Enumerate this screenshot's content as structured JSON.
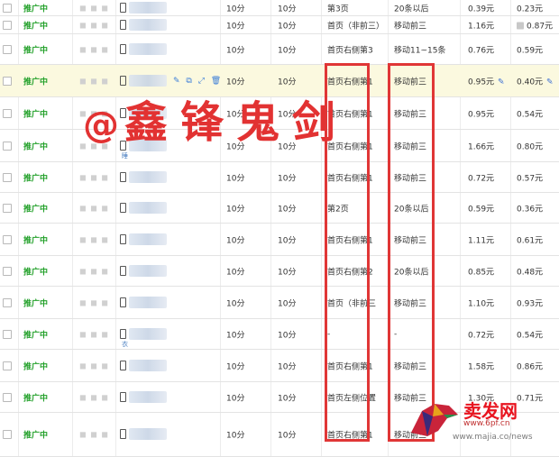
{
  "rows": [
    {
      "status": "推广中",
      "t1": "10分",
      "t2": "10分",
      "pos": "第3页",
      "dev": "20条以后",
      "b1": "0.39元",
      "b2": "0.23元",
      "b2_icon": false,
      "pencil": false,
      "highlight": false,
      "tools": false,
      "sub": ""
    },
    {
      "status": "推广中",
      "t1": "10分",
      "t2": "10分",
      "pos": "首页（非前三）",
      "dev": "移动前三",
      "b1": "1.16元",
      "b2": "0.87元",
      "b2_icon": true,
      "pencil": false,
      "highlight": false,
      "tools": false,
      "sub": ""
    },
    {
      "status": "推广中",
      "t1": "10分",
      "t2": "10分",
      "pos": "首页右侧第3",
      "dev": "移动11~15条",
      "b1": "0.76元",
      "b2": "0.59元",
      "b2_icon": false,
      "pencil": false,
      "highlight": false,
      "tools": false,
      "sub": ""
    },
    {
      "status": "推广中",
      "t1": "10分",
      "t2": "10分",
      "pos": "首页右侧第1",
      "dev": "移动前三",
      "b1": "0.95元",
      "b2": "0.40元",
      "b2_icon": false,
      "pencil": true,
      "highlight": true,
      "tools": true,
      "sub": ""
    },
    {
      "status": "推广中",
      "t1": "10分",
      "t2": "10分",
      "pos": "首页右侧第1",
      "dev": "移动前三",
      "b1": "0.95元",
      "b2": "0.54元",
      "b2_icon": false,
      "pencil": false,
      "highlight": false,
      "tools": false,
      "sub": ""
    },
    {
      "status": "推广中",
      "t1": "10分",
      "t2": "10分",
      "pos": "首页右侧第1",
      "dev": "移动前三",
      "b1": "1.66元",
      "b2": "0.80元",
      "b2_icon": false,
      "pencil": false,
      "highlight": false,
      "tools": false,
      "sub": "睡"
    },
    {
      "status": "推广中",
      "t1": "10分",
      "t2": "10分",
      "pos": "首页右侧第1",
      "dev": "移动前三",
      "b1": "0.72元",
      "b2": "0.57元",
      "b2_icon": false,
      "pencil": false,
      "highlight": false,
      "tools": false,
      "sub": ""
    },
    {
      "status": "推广中",
      "t1": "10分",
      "t2": "10分",
      "pos": "第2页",
      "dev": "20条以后",
      "b1": "0.59元",
      "b2": "0.36元",
      "b2_icon": false,
      "pencil": false,
      "highlight": false,
      "tools": false,
      "sub": ""
    },
    {
      "status": "推广中",
      "t1": "10分",
      "t2": "10分",
      "pos": "首页右侧第1",
      "dev": "移动前三",
      "b1": "1.11元",
      "b2": "0.61元",
      "b2_icon": false,
      "pencil": false,
      "highlight": false,
      "tools": false,
      "sub": ""
    },
    {
      "status": "推广中",
      "t1": "10分",
      "t2": "10分",
      "pos": "首页右侧第2",
      "dev": "20条以后",
      "b1": "0.85元",
      "b2": "0.48元",
      "b2_icon": false,
      "pencil": false,
      "highlight": false,
      "tools": false,
      "sub": ""
    },
    {
      "status": "推广中",
      "t1": "10分",
      "t2": "10分",
      "pos": "首页（非前三",
      "dev": "移动前三",
      "b1": "1.10元",
      "b2": "0.93元",
      "b2_icon": false,
      "pencil": false,
      "highlight": false,
      "tools": false,
      "sub": ""
    },
    {
      "status": "推广中",
      "t1": "10分",
      "t2": "10分",
      "pos": "-",
      "dev": "-",
      "b1": "0.72元",
      "b2": "0.54元",
      "b2_icon": false,
      "pencil": false,
      "highlight": false,
      "tools": false,
      "sub": "衣"
    },
    {
      "status": "推广中",
      "t1": "10分",
      "t2": "10分",
      "pos": "首页右侧第1",
      "dev": "移动前三",
      "b1": "1.58元",
      "b2": "0.86元",
      "b2_icon": false,
      "pencil": false,
      "highlight": false,
      "tools": false,
      "sub": ""
    },
    {
      "status": "推广中",
      "t1": "10分",
      "t2": "10分",
      "pos": "首页左侧位置",
      "dev": "移动前三",
      "b1": "1.30元",
      "b2": "0.71元",
      "b2_icon": false,
      "pencil": false,
      "highlight": false,
      "tools": false,
      "sub": ""
    },
    {
      "status": "推广中",
      "t1": "10分",
      "t2": "10分",
      "pos": "首页右侧第1",
      "dev": "移动前三",
      "b1": "",
      "b2": "",
      "b2_icon": false,
      "pencil": false,
      "highlight": false,
      "tools": false,
      "sub": ""
    }
  ],
  "icons": {
    "keyword_tools": "✎ ⧉ ⤢ 🗑",
    "pencil": "✎"
  },
  "watermark": {
    "at": "@",
    "name": "鑫锋鬼剑"
  },
  "logo": {
    "text": "卖发网",
    "url": "www.6pf.cn",
    "url2": "www.majia.co/news"
  },
  "colors": {
    "status_green": "#24a12b",
    "annotation_red": "#e03636",
    "highlight_row": "#fbf9df"
  }
}
